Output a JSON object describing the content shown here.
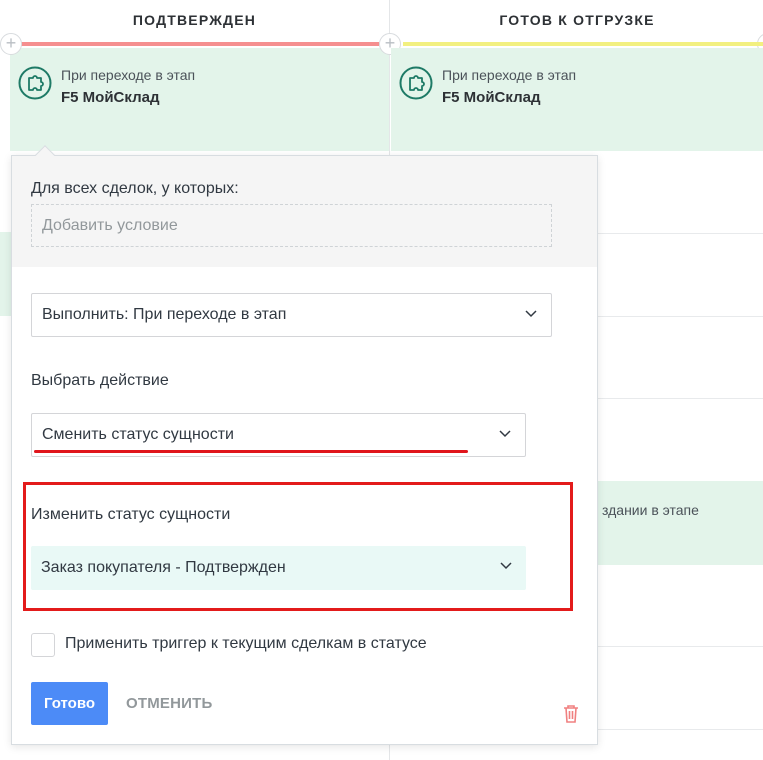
{
  "columns": [
    {
      "title": "ПОДТВЕРЖДЕН",
      "stage_color": "#f58f8f",
      "trigger": {
        "subtitle": "При переходе в этап",
        "title": "F5 МойСклад"
      }
    },
    {
      "title": "ГОТОВ К ОТГРУЗКЕ",
      "stage_color": "#f2f080",
      "trigger": {
        "subtitle": "При переходе в этап",
        "title": "F5 МойСклад"
      },
      "peek_text": "здании в этапе"
    }
  ],
  "popover": {
    "condition_label": "Для всех сделок, у которых:",
    "condition_placeholder": "Добавить условие",
    "execute_select": "Выполнить: При переходе в этап",
    "action_label": "Выбрать действие",
    "action_select": "Сменить статус сущности",
    "status_label": "Изменить статус сущности",
    "status_select": "Заказ покупателя - Подтвержден",
    "apply_checkbox_label": "Применить триггер к текущим сделкам в статусе",
    "apply_checked": false,
    "done_button": "Готово",
    "cancel_button": "ОТМЕНИТЬ"
  },
  "colors": {
    "accent": "#4c8bf7",
    "highlight": "#e31b1b",
    "card": "#e3f4ea",
    "selected_field": "#e9f9f6"
  },
  "icons": [
    "plus-icon",
    "puzzle-icon",
    "chevron-down-icon",
    "trash-icon"
  ]
}
